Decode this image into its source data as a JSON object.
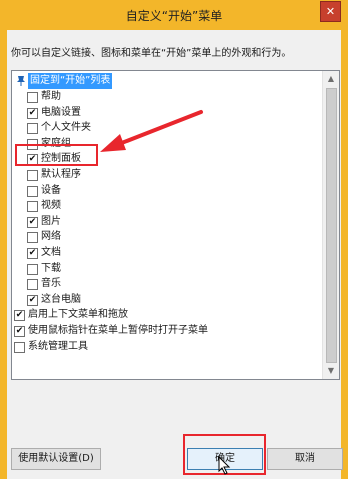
{
  "window": {
    "title": "自定义“开始”菜单",
    "close_label": "✕"
  },
  "description": "你可以自定义链接、图标和菜单在“开始”菜单上的外观和行为。",
  "list": {
    "root_label": "固定到“开始”列表",
    "root_icon": "pin-icon",
    "items": [
      {
        "label": "帮助",
        "checked": false,
        "level": 1
      },
      {
        "label": "电脑设置",
        "checked": true,
        "level": 1
      },
      {
        "label": "个人文件夹",
        "checked": false,
        "level": 1
      },
      {
        "label": "家庭组",
        "checked": false,
        "level": 1
      },
      {
        "label": "控制面板",
        "checked": true,
        "level": 1
      },
      {
        "label": "默认程序",
        "checked": false,
        "level": 1
      },
      {
        "label": "设备",
        "checked": false,
        "level": 1
      },
      {
        "label": "视频",
        "checked": false,
        "level": 1
      },
      {
        "label": "图片",
        "checked": true,
        "level": 1
      },
      {
        "label": "网络",
        "checked": false,
        "level": 1
      },
      {
        "label": "文档",
        "checked": true,
        "level": 1
      },
      {
        "label": "下载",
        "checked": false,
        "level": 1
      },
      {
        "label": "音乐",
        "checked": false,
        "level": 1
      },
      {
        "label": "这台电脑",
        "checked": true,
        "level": 1
      },
      {
        "label": "启用上下文菜单和拖放",
        "checked": true,
        "level": 0
      },
      {
        "label": "使用鼠标指针在菜单上暂停时打开子菜单",
        "checked": true,
        "level": 0
      },
      {
        "label": "系统管理工具",
        "checked": false,
        "level": 0
      }
    ]
  },
  "buttons": {
    "use_default": "使用默认设置(D)",
    "ok": "确定",
    "cancel": "取消"
  },
  "colors": {
    "title_bar": "#f3b62a",
    "close_button": "#c7402d",
    "selection": "#3399ff",
    "annotation": "#e8262d"
  }
}
